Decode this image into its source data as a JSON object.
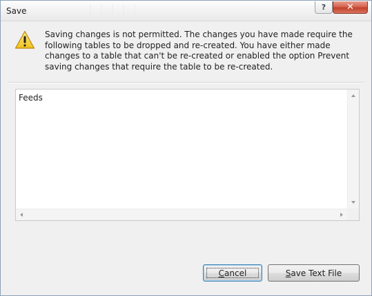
{
  "window": {
    "title": "Save",
    "help_glyph": "?",
    "close_glyph": "✕"
  },
  "message": {
    "icon": "warning-icon",
    "text": "Saving changes is not permitted. The changes you have made require the following tables to be dropped and re-created. You have either made changes to a table that can't be re-created or enabled the option Prevent saving changes that require the table to be re-created."
  },
  "details": {
    "content": "Feeds"
  },
  "buttons": {
    "cancel_label": "Cancel",
    "save_text_file_label": "Save Text File"
  },
  "colors": {
    "dialog_background": "#f0f0f0",
    "close_button": "#c7442d",
    "warning_yellow": "#f7d22c",
    "focus_border": "#3c7fb1"
  }
}
